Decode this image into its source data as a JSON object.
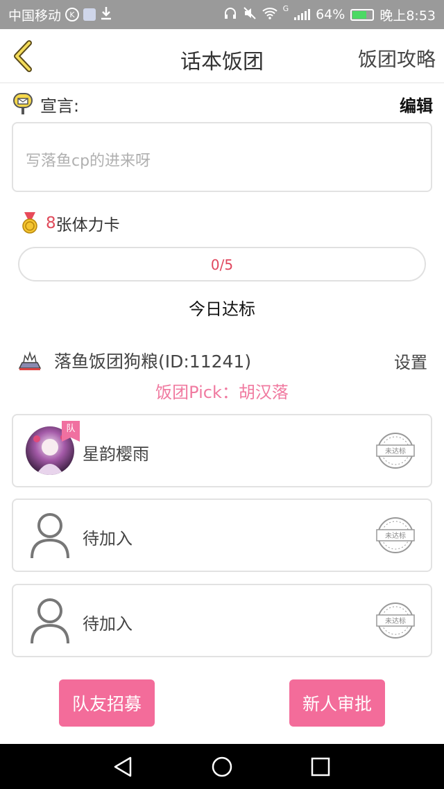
{
  "status_bar": {
    "carrier": "中国移动",
    "carrier_badge": "K",
    "signal_type": "G",
    "battery": "64%",
    "time": "晚上8:53"
  },
  "header": {
    "title": "话本饭团",
    "right_link": "饭团攻略"
  },
  "declaration": {
    "label": "宣言:",
    "edit": "编辑",
    "placeholder": "写落鱼cp的进来呀"
  },
  "stamina": {
    "count": "8",
    "label": "张体力卡"
  },
  "progress": {
    "text": "0/5",
    "value": 0
  },
  "today_status": "今日达标",
  "group": {
    "name": "落鱼饭团狗粮(ID:11241)",
    "settings": "设置",
    "pick": "饭团Pick：胡汉落"
  },
  "members": [
    {
      "name": "星韵樱雨",
      "badge": "队",
      "status": "未达标"
    },
    {
      "name": "待加入",
      "status": "未达标"
    },
    {
      "name": "待加入",
      "status": "未达标"
    }
  ],
  "buttons": {
    "recruit": "队友招募",
    "approve": "新人审批"
  },
  "colors": {
    "accent_pink": "#f36c9a",
    "pick_pink": "#f07aa0",
    "number_red": "#e04a5a"
  }
}
